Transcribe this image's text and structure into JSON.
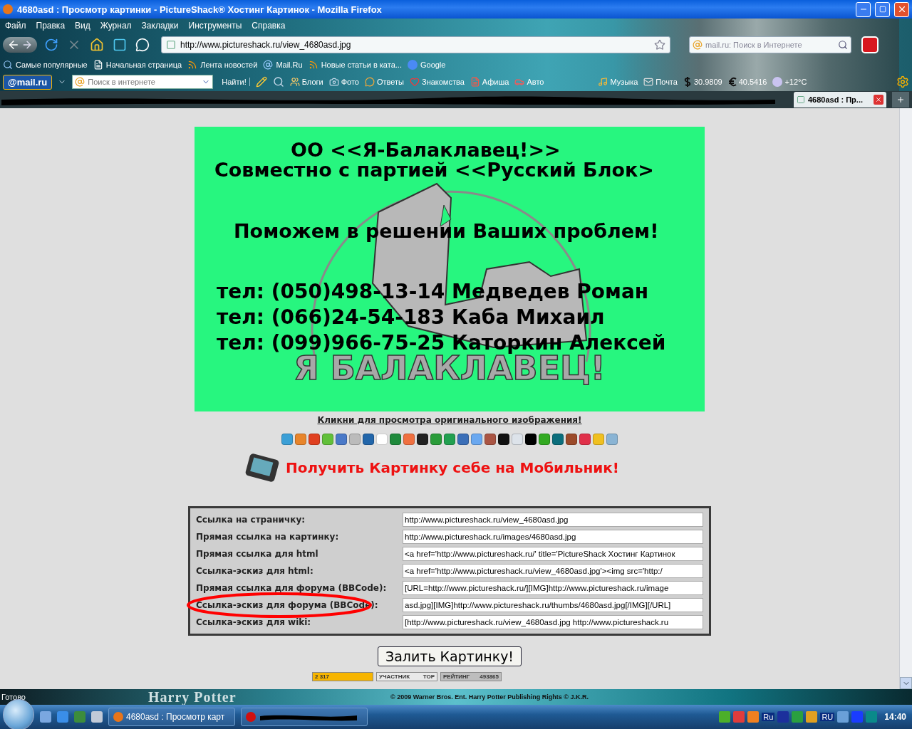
{
  "window": {
    "title": "4680asd : Просмотр картинки - PictureShack® Хостинг Картинок - Mozilla Firefox"
  },
  "menu": [
    "Файл",
    "Правка",
    "Вид",
    "Журнал",
    "Закладки",
    "Инструменты",
    "Справка"
  ],
  "address_bar": {
    "value": "http://www.pictureshack.ru/view_4680asd.jpg"
  },
  "search": {
    "placeholder": "mail.ru: Поиск в Интернете"
  },
  "bookmarks": [
    {
      "label": "Самые популярные",
      "kind": "search"
    },
    {
      "label": "Начальная страница",
      "kind": "page"
    },
    {
      "label": "Лента новостей",
      "kind": "rss"
    },
    {
      "label": "Mail.Ru",
      "kind": "mail"
    },
    {
      "label": "Новые статьи в ката...",
      "kind": "rss"
    },
    {
      "label": "Google",
      "kind": "google"
    }
  ],
  "mail_toolbar": {
    "logo": "@mail.ru",
    "search_placeholder": "Поиск в интернете",
    "find_button": "Найти!",
    "items": [
      {
        "label": "Блоги",
        "kind": "blog"
      },
      {
        "label": "Фото",
        "kind": "photo"
      },
      {
        "label": "Ответы",
        "kind": "answers"
      },
      {
        "label": "Знакомства",
        "kind": "dating"
      },
      {
        "label": "Афиша",
        "kind": "poster"
      },
      {
        "label": "Авто",
        "kind": "car"
      }
    ],
    "widgets": [
      {
        "label": "Музыка",
        "kind": "music"
      },
      {
        "label": "Почта",
        "kind": "mail"
      },
      {
        "label": "30.9809",
        "kind": "dollar"
      },
      {
        "label": "40.5416",
        "kind": "euro"
      },
      {
        "label": "+12°C",
        "kind": "weather"
      }
    ]
  },
  "tabs": [
    {
      "label": "4680asd : Пр...",
      "selected": true
    }
  ],
  "banner": {
    "title": "ОО <<Я-Балаклавец!>>",
    "subtitle": "Совместно с партией <<Русский Блок>",
    "slogan": "Поможем в решении Ваших проблем!",
    "contacts": [
      "тел: (050)498-13-14 Медведев Роман",
      "тел: (066)24-54-183 Каба Михаил",
      "тел: (099)966-75-25 Каторкин Алексей"
    ],
    "logo_caption": "Я БАЛАКЛАВЕЦ!"
  },
  "original_link": "Кликни для просмотра оригинального изображения!",
  "mobile_link": "Получить Картинку себе на Мобильник!",
  "links": [
    {
      "label": "Ссылка на страничку:",
      "value": "http://www.pictureshack.ru/view_4680asd.jpg",
      "highlighted": false
    },
    {
      "label": "Прямая ссылка на картинку:",
      "value": "http://www.pictureshack.ru/images/4680asd.jpg",
      "highlighted": false
    },
    {
      "label": "Прямая ссылка для html",
      "value": "<a href='http://www.pictureshack.ru/' title='PictureShack Хостинг Картинок",
      "highlighted": false
    },
    {
      "label": "Ссылка-эскиз для html:",
      "value": "<a href='http://www.pictureshack.ru/view_4680asd.jpg'><img src='http:/",
      "highlighted": false
    },
    {
      "label": "Прямая ссылка для форума (BBCode):",
      "value": "[URL=http://www.pictureshack.ru/][IMG]http://www.pictureshack.ru/image",
      "highlighted": false
    },
    {
      "label": "Ссылка-эскиз для форума (BBCode):",
      "value": "asd.jpg][IMG]http://www.pictureshack.ru/thumbs/4680asd.jpg[/IMG][/URL]",
      "highlighted": true
    },
    {
      "label": "Ссылка-эскиз для wiki:",
      "value": "[http://www.pictureshack.ru/view_4680asd.jpg http://www.pictureshack.ru",
      "highlighted": false
    }
  ],
  "upload_button": "Залить Картинку!",
  "counters": [
    {
      "kind": "visits",
      "text": "2 317"
    },
    {
      "kind": "member",
      "text": "УЧАСТНИК",
      "badge": "TOP"
    },
    {
      "kind": "rating",
      "text": "РЕЙТИНГ",
      "value": "493865"
    }
  ],
  "status_bar": {
    "text": "Готово",
    "logo": "Harry Potter",
    "copyright": "© 2009 Warner Bros. Ent. Harry Potter Publishing Rights © J.K.R."
  },
  "taskbar": {
    "tasks": [
      {
        "label": "4680asd : Просмотр карт",
        "kind": "firefox"
      },
      {
        "kind": "opera"
      }
    ],
    "tray": [
      "Ru",
      "RU"
    ],
    "clock": "14:40"
  }
}
